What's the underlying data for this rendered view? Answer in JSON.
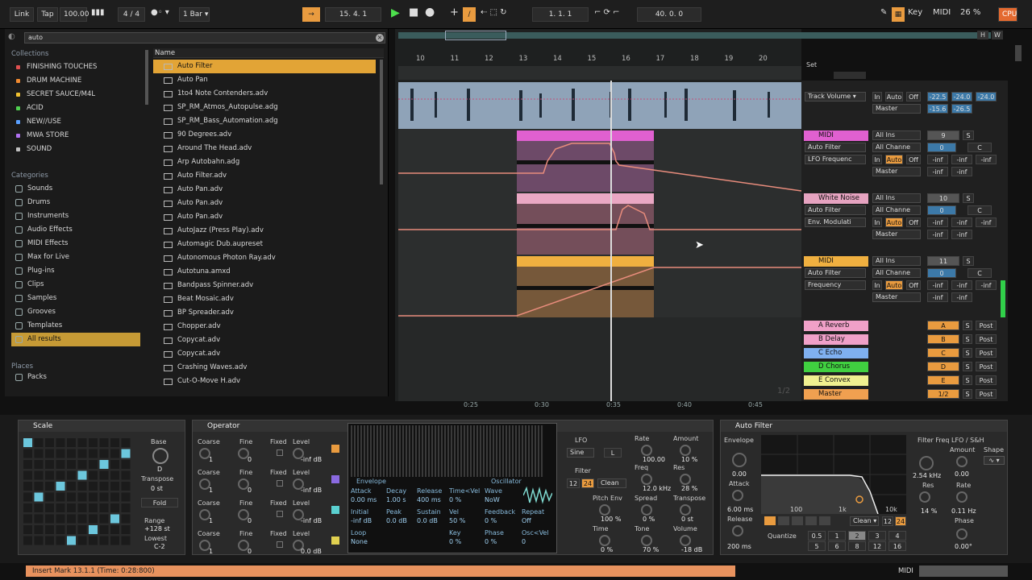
{
  "transport": {
    "link": "Link",
    "tap": "Tap",
    "tempo": "100.00",
    "signature": "4 / 4",
    "quantize": "1 Bar",
    "position": "15.  4.  1",
    "loop_start": "1.  1.  1",
    "loop_length": "40.  0.  0",
    "key": "Key",
    "midi": "MIDI",
    "cpu": "26 %",
    "cpu_label": "CPU"
  },
  "browser": {
    "search_value": "auto",
    "collections_title": "Collections",
    "collections": [
      {
        "label": "FINISHING TOUCHES",
        "color": "#e05050"
      },
      {
        "label": "DRUM MACHINE",
        "color": "#f08a30"
      },
      {
        "label": "SECRET SAUCE/M4L",
        "color": "#f0c030"
      },
      {
        "label": "ACID",
        "color": "#50d050"
      },
      {
        "label": "NEW//USE",
        "color": "#5aa0ff"
      },
      {
        "label": "MWA STORE",
        "color": "#b070f0"
      },
      {
        "label": "SOUND",
        "color": "#c0c0c0"
      }
    ],
    "categories_title": "Categories",
    "categories": [
      "Sounds",
      "Drums",
      "Instruments",
      "Audio Effects",
      "MIDI Effects",
      "Max for Live",
      "Plug-ins",
      "Clips",
      "Samples",
      "Grooves",
      "Templates",
      "All results"
    ],
    "places_title": "Places",
    "places": [
      "Packs"
    ],
    "name_header": "Name",
    "files": [
      "Auto Filter",
      "Auto Pan",
      "1to4 Note Contenders.adv",
      "SP_RM_Atmos_Autopulse.adg",
      "SP_RM_Bass_Automation.adg",
      "90 Degrees.adv",
      "Around The Head.adv",
      "Arp Autobahn.adg",
      "Auto Filter.adv",
      "Auto Pan.adv",
      "Auto Pan.adv",
      "Auto Pan.adv",
      "AutoJazz (Press Play).adv",
      "Automagic Dub.aupreset",
      "Autonomous Photon Ray.adv",
      "Autotuna.amxd",
      "Bandpass Spinner.adv",
      "Beat Mosaic.adv",
      "BP Spreader.adv",
      "Chopper.adv",
      "Copycat.adv",
      "Copycat.adv",
      "Crashing Waves.adv",
      "Cut-O-Move H.adv"
    ]
  },
  "arrangement": {
    "ruler": [
      "10",
      "11",
      "12",
      "13",
      "14",
      "15",
      "16",
      "17",
      "18",
      "19",
      "20"
    ],
    "time_ruler": [
      "0:25",
      "0:30",
      "0:35",
      "0:40",
      "0:45"
    ],
    "page": "1/2",
    "set_label": "Set"
  },
  "mixer": {
    "track_volume": "Track Volume",
    "tracks": [
      {
        "name": "MIDI",
        "color": "#e060d0",
        "device": "Auto Filter",
        "param": "LFO Frequenc",
        "input": "All Ins",
        "channel": "All Channe",
        "num": "9"
      },
      {
        "name": "White Noise",
        "color": "#e6a3c0",
        "device": "Auto Filter",
        "param": "Env. Modulati",
        "input": "All Ins",
        "channel": "All Channe",
        "num": "10"
      },
      {
        "name": "MIDI",
        "color": "#f0b040",
        "device": "Auto Filter",
        "param": "Frequency",
        "input": "All Ins",
        "channel": "All Channe",
        "num": "11"
      }
    ],
    "returns": [
      {
        "name": "A Reverb",
        "color": "#f0a0c8",
        "send": "A"
      },
      {
        "name": "B Delay",
        "color": "#f0a0c8",
        "send": "B"
      },
      {
        "name": "C Echo",
        "color": "#7fb0f0",
        "send": "C"
      },
      {
        "name": "D Chorus",
        "color": "#40d040",
        "send": "D"
      },
      {
        "name": "E Convex",
        "color": "#f0f090",
        "send": "E"
      },
      {
        "name": "Master",
        "color": "#f0a050",
        "send": "1/2"
      }
    ],
    "master": "Master",
    "in": "In",
    "auto": "Auto",
    "off": "Off",
    "inf": "-inf",
    "vols": [
      "-22.5",
      "-24.0",
      "-24.0",
      "-15.6",
      "-26.5"
    ],
    "post": "Post",
    "s": "S",
    "c": "C",
    "zero": "0"
  },
  "scale": {
    "title": "Scale",
    "base": "Base",
    "base_val": "D",
    "transpose": "Transpose",
    "transpose_val": "0 st",
    "fold": "Fold",
    "range": "Range",
    "range_val": "+128 st",
    "lowest": "Lowest",
    "lowest_val": "C-2"
  },
  "operator": {
    "title": "Operator",
    "osc": [
      {
        "coarse": "1",
        "fine": "0",
        "level": "-inf dB"
      },
      {
        "coarse": "1",
        "fine": "0",
        "level": "-inf dB"
      },
      {
        "coarse": "1",
        "fine": "0",
        "level": "-inf dB"
      },
      {
        "coarse": "1",
        "fine": "0",
        "level": "0.0 dB"
      }
    ],
    "coarse": "Coarse",
    "fine": "Fine",
    "fixed": "Fixed",
    "level": "Level",
    "env_title": "Envelope",
    "osc_title": "Oscillator",
    "attack": "Attack",
    "attack_val": "0.00 ms",
    "decay": "Decay",
    "decay_val": "1.00 s",
    "release": "Release",
    "release_val": "400 ms",
    "timevel": "Time<Vel",
    "timevel_val": "0 %",
    "initial": "Initial",
    "initial_val": "-inf dB",
    "peak": "Peak",
    "peak_val": "0.0 dB",
    "sustain": "Sustain",
    "sustain_val": "0.0 dB",
    "vel": "Vel",
    "vel_val": "50 %",
    "loop": "Loop",
    "loop_val": "None",
    "key": "Key",
    "key_val": "0 %",
    "wave": "Wave",
    "wave_val": "NoW",
    "feedback": "Feedback",
    "feedback_val": "0 %",
    "repeat": "Repeat",
    "repeat_val": "Off",
    "phase": "Phase",
    "phase_val": "0 %",
    "oscvel": "Osc<Vel",
    "oscvel_val": "0",
    "lfo": "LFO",
    "lfo_wave": "Sine",
    "lfo_l": "L",
    "rate": "Rate",
    "rate_val": "100.00",
    "amount": "Amount",
    "amount_val": "10 %",
    "filter": "Filter",
    "filter_12": "12",
    "filter_24": "24",
    "clean": "Clean",
    "freq": "Freq",
    "freq_val": "12.0 kHz",
    "res": "Res",
    "res_val": "28 %",
    "pitch_env": "Pitch Env",
    "pitch_env_val": "100 %",
    "spread": "Spread",
    "spread_val": "0 %",
    "transpose": "Transpose",
    "transpose_val": "0 st",
    "time": "Time",
    "time_val": "0 %",
    "tone": "Tone",
    "tone_val": "70 %",
    "volume": "Volume",
    "volume_val": "-18 dB"
  },
  "autofilter": {
    "title": "Auto Filter",
    "envelope": "Envelope",
    "env_val": "0.00",
    "attack": "Attack",
    "attack_val": "6.00 ms",
    "release": "Release",
    "release_val": "200 ms",
    "filter_freq": "Filter Freq",
    "freq_val": "2.54 kHz",
    "res": "Res",
    "res_val": "14 %",
    "lfo": "LFO / S&H",
    "amount": "Amount",
    "amount_val": "0.00",
    "rate": "Rate",
    "rate_val": "0.11 Hz",
    "phase": "Phase",
    "phase_val": "0.00°",
    "shape": "Shape",
    "clean": "Clean",
    "f12": "12",
    "f24": "24",
    "quantize": "Quantize",
    "q_vals": [
      "0.5",
      "1",
      "2",
      "3",
      "4",
      "5",
      "6",
      "8",
      "12",
      "16"
    ],
    "axis": [
      "100",
      "1k",
      "10k"
    ]
  },
  "status": {
    "message": "Insert Mark 13.1.1 (Time: 0:28:800)",
    "midi": "MIDI"
  }
}
